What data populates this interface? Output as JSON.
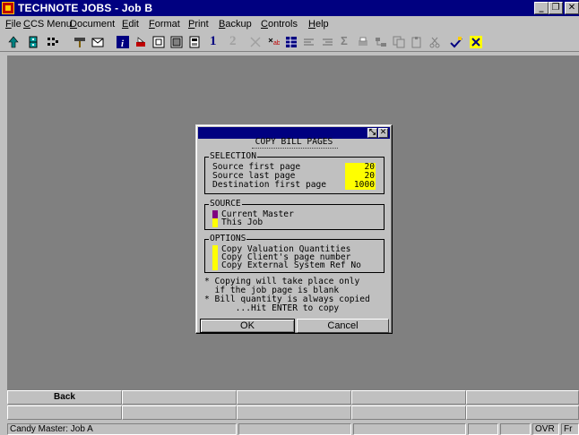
{
  "window": {
    "title": "TECHNOTE JOBS - Job B",
    "minimize_glyph": "_",
    "maximize_glyph": "❐",
    "close_glyph": "✕"
  },
  "menu": [
    "File",
    "CCS Menu",
    "Document",
    "Edit",
    "Format",
    "Print",
    "Backup",
    "Controls",
    "Help"
  ],
  "toolbar": {
    "icons": [
      "arrow-up-icon",
      "cabinet-icon",
      "grid-icon",
      "hammer-icon",
      "mail-icon",
      "info-icon",
      "printer-icon",
      "sheet-icon",
      "sheet-alt-icon",
      "calculator-icon",
      "number-one-icon",
      "number-two-icon",
      "cross-icon",
      "sparkle-icon",
      "table-icon",
      "list-icon",
      "list-alt-icon",
      "sum-icon",
      "print-preview-icon",
      "tree-icon",
      "copy-icon",
      "paste-icon",
      "scissors-icon",
      "check-icon",
      "star-icon"
    ],
    "one_label": "1",
    "two_label": "2",
    "sum_label": "Σ"
  },
  "dialog": {
    "help_glyph": "⤡",
    "close_glyph": "✕",
    "title": "COPY BILL PAGES",
    "title_underline": "~~~~~~~~~~~~~~~",
    "selection": {
      "legend": "SELECTION",
      "rows": [
        {
          "label": "Source first page",
          "value": "20"
        },
        {
          "label": "Source last page",
          "value": "20"
        },
        {
          "label": "Destination first page",
          "value": "1000"
        }
      ]
    },
    "source": {
      "legend": "SOURCE",
      "options": [
        "Current Master",
        "This Job"
      ],
      "selected": "Current Master"
    },
    "options": {
      "legend": "OPTIONS",
      "items": [
        "Copy Valuation Quantities",
        "Copy Client's page number",
        "Copy External System Ref No"
      ]
    },
    "notes": [
      "* Copying will take place only",
      "  if the job page is blank",
      "* Bill quantity is always copied",
      "      ...Hit ENTER to copy"
    ],
    "ok_label": "OK",
    "cancel_label": "Cancel"
  },
  "function_keys": {
    "row1": [
      "Back",
      "",
      "",
      "",
      ""
    ],
    "row2": [
      "",
      "",
      "",
      "",
      ""
    ]
  },
  "status": {
    "master": "Candy Master: Job A",
    "mode": "OVR",
    "extra": "Fr"
  },
  "colors": {
    "titlebar": "#000080",
    "workspace": "#808080",
    "field_highlight": "#ffff00",
    "selected_marker": "#800080"
  }
}
